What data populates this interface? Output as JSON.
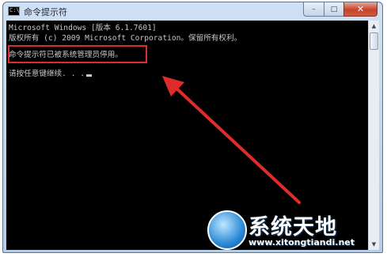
{
  "window": {
    "title": "命令提示符",
    "icon_label": "C:\\",
    "icon_name": "cmd-icon",
    "controls": {
      "minimize": "–",
      "maximize": "□",
      "close": "✕"
    }
  },
  "console": {
    "lines": [
      "Microsoft Windows [版本 6.1.7601]",
      "版权所有 (c) 2009 Microsoft Corporation。保留所有权利。",
      "命令提示符已被系统管理员停用。",
      "请按任意键继续. . ."
    ]
  },
  "scrollbar": {
    "up": "▲",
    "down": "▼"
  },
  "annotation": {
    "color": "#e02b2b"
  },
  "watermark": {
    "title": "系统天地",
    "url": "www.xitongtiandi.net"
  }
}
